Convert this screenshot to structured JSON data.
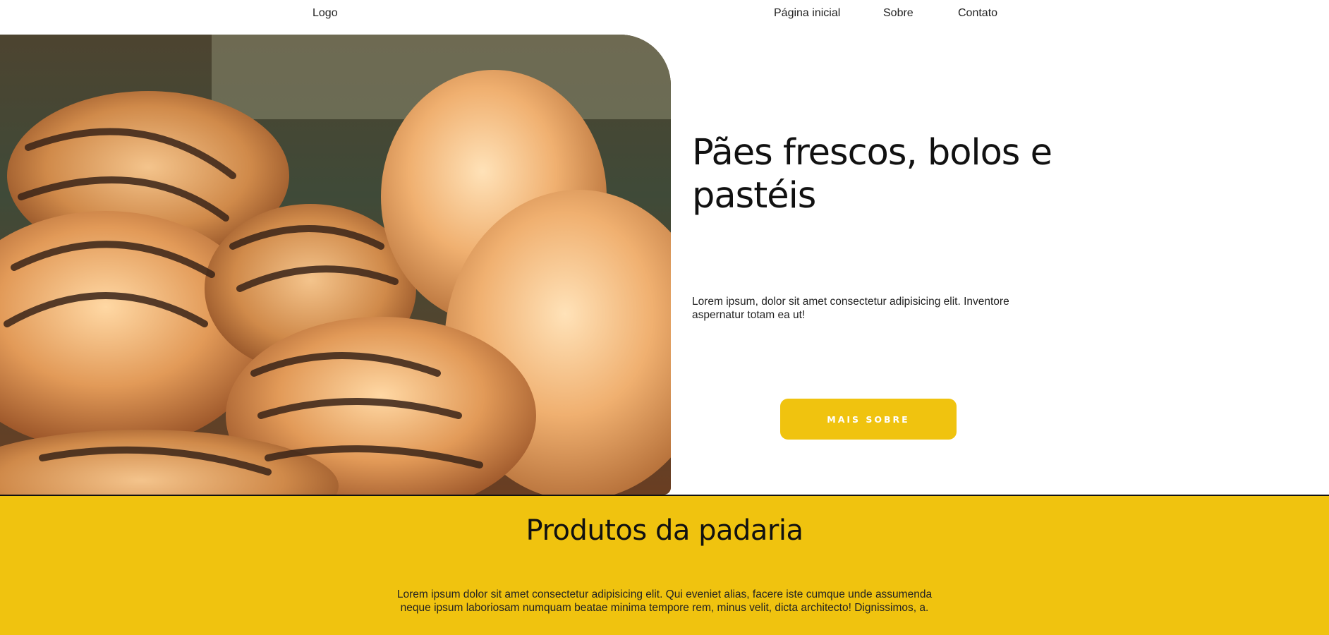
{
  "nav": {
    "logo": "Logo",
    "links": [
      "Página inicial",
      "Sobre",
      "Contato"
    ]
  },
  "hero": {
    "title": "Pães frescos, bolos e pastéis",
    "text": "Lorem ipsum, dolor sit amet consectetur adipisicing elit. Inventore aspernatur totam ea ut!",
    "button_label": "MAIS SOBRE",
    "image_subject": "croissants-pastries-photo"
  },
  "products": {
    "title": "Produtos da padaria",
    "text": "Lorem ipsum dolor sit amet consectetur adipisicing elit. Qui eveniet alias, facere iste cumque unde assumenda neque ipsum laboriosam numquam beatae minima tempore rem, minus velit, dicta architecto! Dignissimos, a."
  },
  "colors": {
    "accent": "#f0c30f",
    "text": "#111111",
    "background": "#ffffff"
  }
}
